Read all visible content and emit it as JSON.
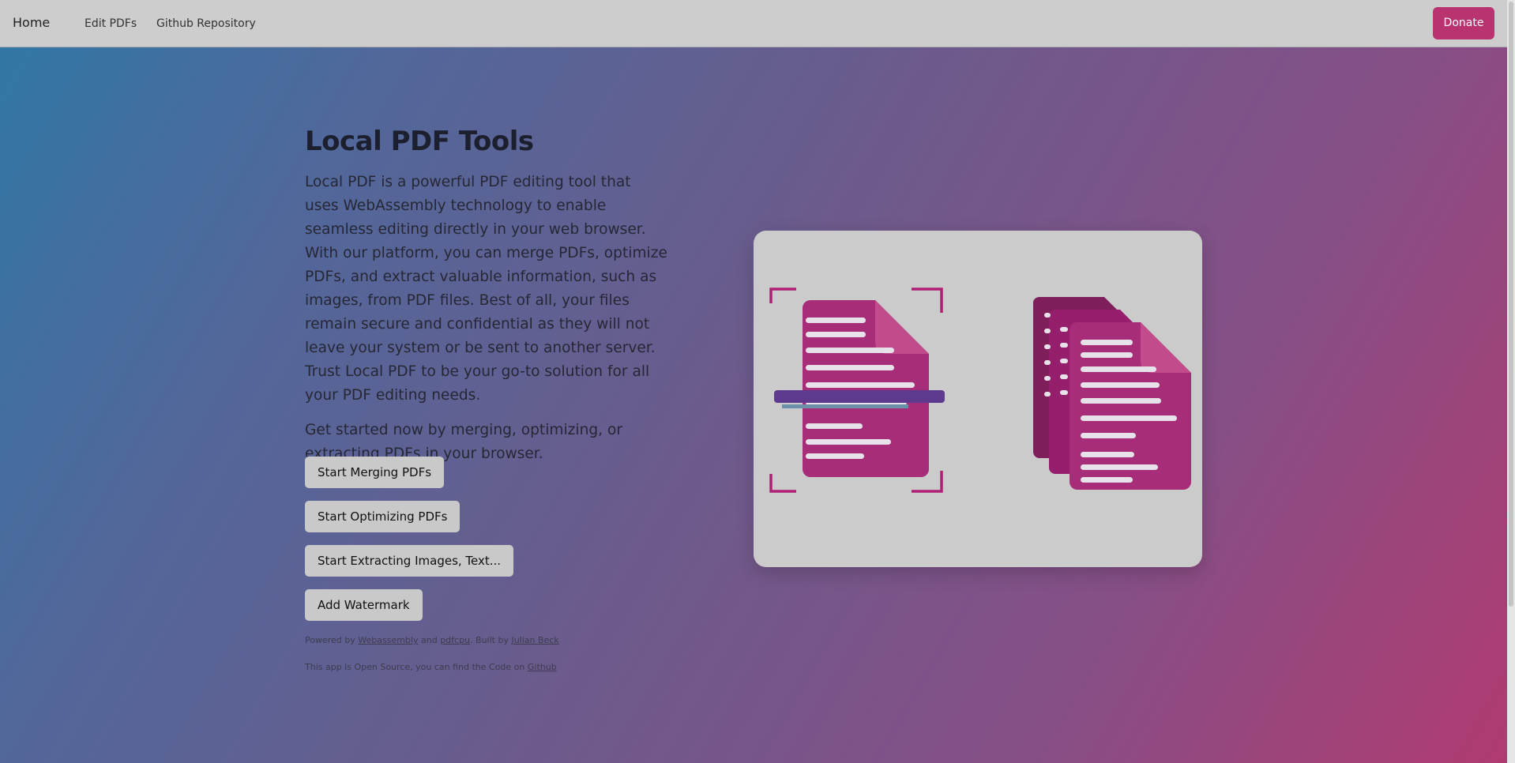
{
  "nav": {
    "home": "Home",
    "edit_pdfs": "Edit PDFs",
    "github_repository": "Github Repository",
    "donate": "Donate"
  },
  "hero": {
    "title": "Local PDF Tools",
    "description": "Local PDF is a powerful PDF editing tool that uses WebAssembly technology to enable seamless editing directly in your web browser. With our platform, you can merge PDFs, optimize PDFs, and extract valuable information, such as images, from PDF files. Best of all, your files remain secure and confidential as they will not leave your system or be sent to another server. Trust Local PDF to be your go-to solution for all your PDF editing needs.",
    "cta": "Get started now by merging, optimizing, or extracting PDFs in your browser."
  },
  "buttons": {
    "merge": "Start Merging PDFs",
    "optimize": "Start Optimizing PDFs",
    "extract": "Start Extracting Images, Text...",
    "watermark": "Add Watermark"
  },
  "footer": {
    "powered_by": "Powered by ",
    "webassembly": "Webassembly",
    "and": " and ",
    "pdfcpu": "pdfcpu",
    "built_by": ". Built by ",
    "author": "Julian Beck",
    "open_source": "This app is Open Source, you can find the Code on ",
    "github": "Github"
  },
  "colors": {
    "accent": "#b8336f",
    "document": "#a72d78",
    "document_dark": "#7e1e5a",
    "scanner_bar": "#5e3a8f"
  },
  "illustration": {
    "left": "scan-document-icon",
    "right": "stacked-documents-icon"
  }
}
